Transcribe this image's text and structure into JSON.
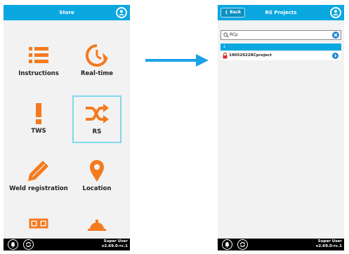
{
  "colors": {
    "accent": "#0aa7e0",
    "screen_bg": "#f2f2f2",
    "icon_orange": "#f47a20",
    "lock_red": "#d9302c"
  },
  "left_phone": {
    "header_title": "Store",
    "tiles": [
      {
        "label": "Instructions",
        "icon": "list-icon"
      },
      {
        "label": "Real-time",
        "icon": "clock-refresh-icon"
      },
      {
        "label": "TWS",
        "icon": "exclamation-icon"
      },
      {
        "label": "RS",
        "icon": "shuffle-icon",
        "selected": true
      },
      {
        "label": "Weld registration",
        "icon": "pencil-icon"
      },
      {
        "label": "Location",
        "icon": "map-pin-icon"
      },
      {
        "label": "",
        "icon": "grid-icon"
      },
      {
        "label": "",
        "icon": "hard-hat-icon"
      }
    ],
    "user_name": "Super User",
    "version": "v2.69.0-rc.1"
  },
  "right_phone": {
    "back_label": "Back",
    "header_title": "RS Projects",
    "search_value": "RCp",
    "section_header": "1",
    "projects": [
      {
        "name": "19052022RCproject",
        "locked": true
      }
    ],
    "user_name": "Super User",
    "version": "v2.69.0-rc.1"
  },
  "transition_arrow": "arrow-right-icon"
}
